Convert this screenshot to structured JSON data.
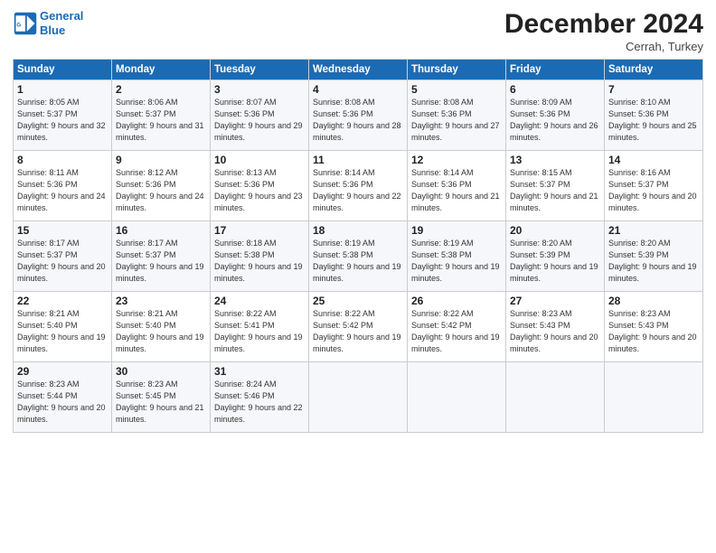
{
  "logo": {
    "line1": "General",
    "line2": "Blue"
  },
  "title": "December 2024",
  "subtitle": "Cerrah, Turkey",
  "days": [
    "Sunday",
    "Monday",
    "Tuesday",
    "Wednesday",
    "Thursday",
    "Friday",
    "Saturday"
  ],
  "weeks": [
    [
      {
        "day": "1",
        "sunrise": "8:05 AM",
        "sunset": "5:37 PM",
        "daylight": "9 hours and 32 minutes."
      },
      {
        "day": "2",
        "sunrise": "8:06 AM",
        "sunset": "5:37 PM",
        "daylight": "9 hours and 31 minutes."
      },
      {
        "day": "3",
        "sunrise": "8:07 AM",
        "sunset": "5:36 PM",
        "daylight": "9 hours and 29 minutes."
      },
      {
        "day": "4",
        "sunrise": "8:08 AM",
        "sunset": "5:36 PM",
        "daylight": "9 hours and 28 minutes."
      },
      {
        "day": "5",
        "sunrise": "8:08 AM",
        "sunset": "5:36 PM",
        "daylight": "9 hours and 27 minutes."
      },
      {
        "day": "6",
        "sunrise": "8:09 AM",
        "sunset": "5:36 PM",
        "daylight": "9 hours and 26 minutes."
      },
      {
        "day": "7",
        "sunrise": "8:10 AM",
        "sunset": "5:36 PM",
        "daylight": "9 hours and 25 minutes."
      }
    ],
    [
      {
        "day": "8",
        "sunrise": "8:11 AM",
        "sunset": "5:36 PM",
        "daylight": "9 hours and 24 minutes."
      },
      {
        "day": "9",
        "sunrise": "8:12 AM",
        "sunset": "5:36 PM",
        "daylight": "9 hours and 24 minutes."
      },
      {
        "day": "10",
        "sunrise": "8:13 AM",
        "sunset": "5:36 PM",
        "daylight": "9 hours and 23 minutes."
      },
      {
        "day": "11",
        "sunrise": "8:14 AM",
        "sunset": "5:36 PM",
        "daylight": "9 hours and 22 minutes."
      },
      {
        "day": "12",
        "sunrise": "8:14 AM",
        "sunset": "5:36 PM",
        "daylight": "9 hours and 21 minutes."
      },
      {
        "day": "13",
        "sunrise": "8:15 AM",
        "sunset": "5:37 PM",
        "daylight": "9 hours and 21 minutes."
      },
      {
        "day": "14",
        "sunrise": "8:16 AM",
        "sunset": "5:37 PM",
        "daylight": "9 hours and 20 minutes."
      }
    ],
    [
      {
        "day": "15",
        "sunrise": "8:17 AM",
        "sunset": "5:37 PM",
        "daylight": "9 hours and 20 minutes."
      },
      {
        "day": "16",
        "sunrise": "8:17 AM",
        "sunset": "5:37 PM",
        "daylight": "9 hours and 19 minutes."
      },
      {
        "day": "17",
        "sunrise": "8:18 AM",
        "sunset": "5:38 PM",
        "daylight": "9 hours and 19 minutes."
      },
      {
        "day": "18",
        "sunrise": "8:19 AM",
        "sunset": "5:38 PM",
        "daylight": "9 hours and 19 minutes."
      },
      {
        "day": "19",
        "sunrise": "8:19 AM",
        "sunset": "5:38 PM",
        "daylight": "9 hours and 19 minutes."
      },
      {
        "day": "20",
        "sunrise": "8:20 AM",
        "sunset": "5:39 PM",
        "daylight": "9 hours and 19 minutes."
      },
      {
        "day": "21",
        "sunrise": "8:20 AM",
        "sunset": "5:39 PM",
        "daylight": "9 hours and 19 minutes."
      }
    ],
    [
      {
        "day": "22",
        "sunrise": "8:21 AM",
        "sunset": "5:40 PM",
        "daylight": "9 hours and 19 minutes."
      },
      {
        "day": "23",
        "sunrise": "8:21 AM",
        "sunset": "5:40 PM",
        "daylight": "9 hours and 19 minutes."
      },
      {
        "day": "24",
        "sunrise": "8:22 AM",
        "sunset": "5:41 PM",
        "daylight": "9 hours and 19 minutes."
      },
      {
        "day": "25",
        "sunrise": "8:22 AM",
        "sunset": "5:42 PM",
        "daylight": "9 hours and 19 minutes."
      },
      {
        "day": "26",
        "sunrise": "8:22 AM",
        "sunset": "5:42 PM",
        "daylight": "9 hours and 19 minutes."
      },
      {
        "day": "27",
        "sunrise": "8:23 AM",
        "sunset": "5:43 PM",
        "daylight": "9 hours and 20 minutes."
      },
      {
        "day": "28",
        "sunrise": "8:23 AM",
        "sunset": "5:43 PM",
        "daylight": "9 hours and 20 minutes."
      }
    ],
    [
      {
        "day": "29",
        "sunrise": "8:23 AM",
        "sunset": "5:44 PM",
        "daylight": "9 hours and 20 minutes."
      },
      {
        "day": "30",
        "sunrise": "8:23 AM",
        "sunset": "5:45 PM",
        "daylight": "9 hours and 21 minutes."
      },
      {
        "day": "31",
        "sunrise": "8:24 AM",
        "sunset": "5:46 PM",
        "daylight": "9 hours and 22 minutes."
      },
      null,
      null,
      null,
      null
    ]
  ]
}
